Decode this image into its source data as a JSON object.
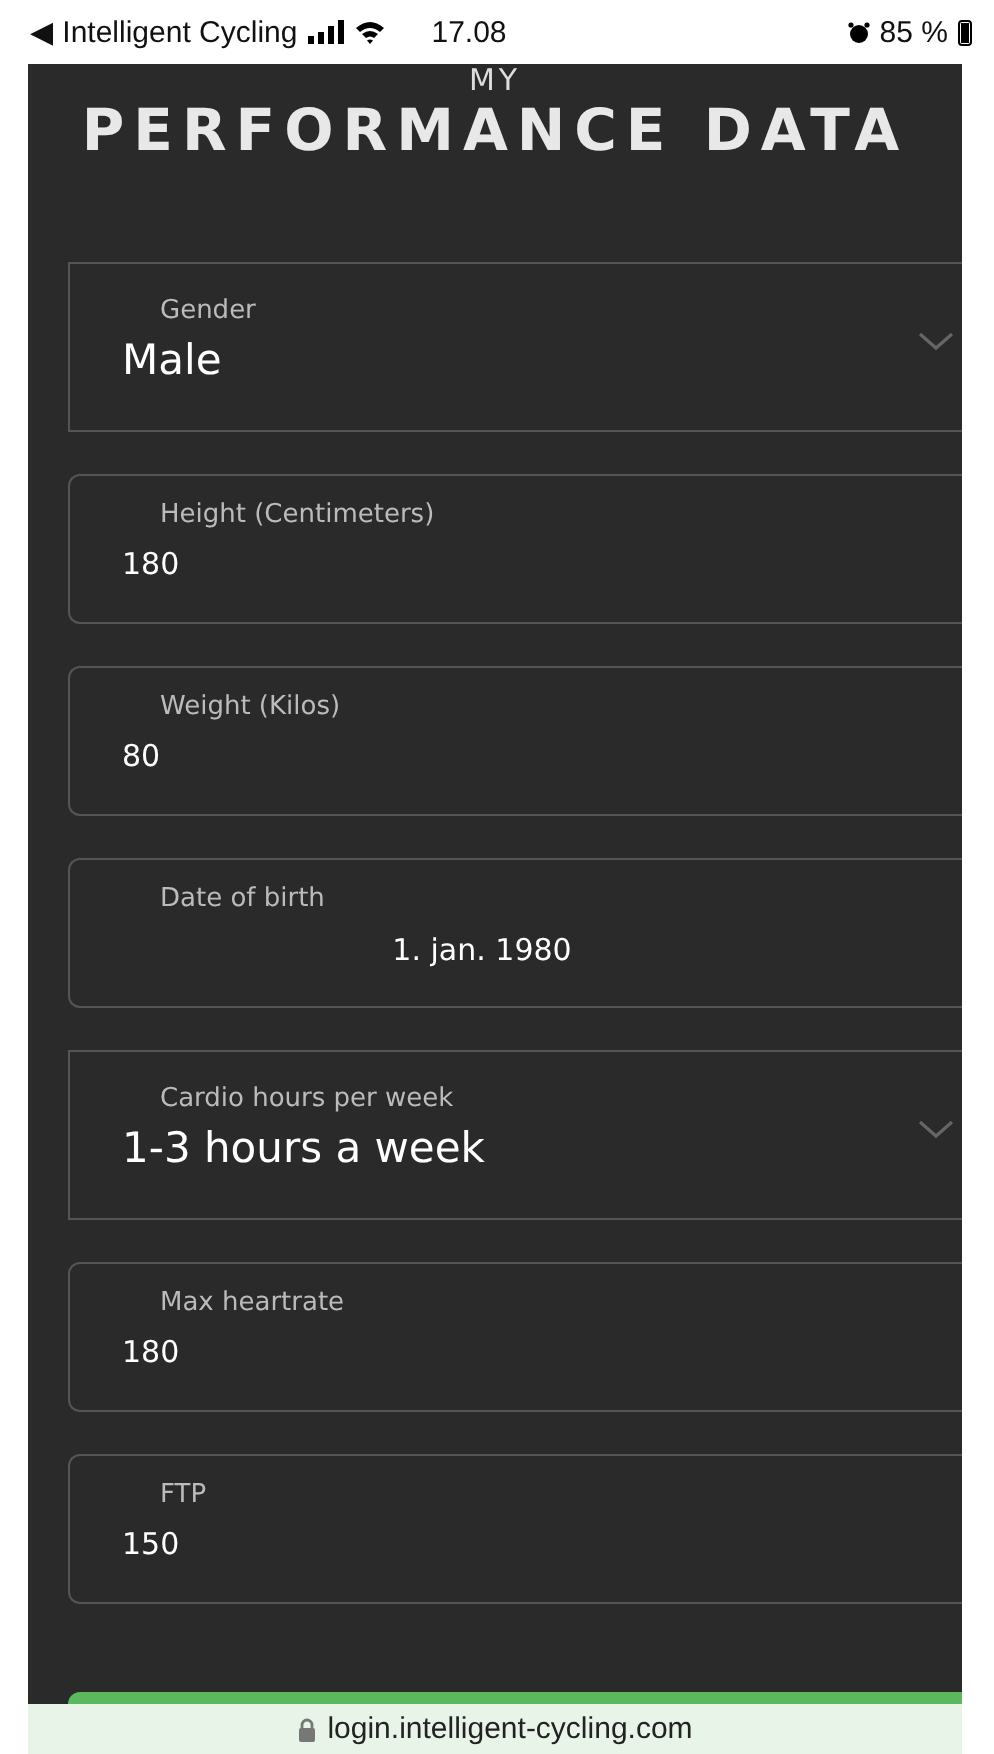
{
  "status_bar": {
    "back_app": "◀ Intelligent Cycling",
    "time": "17.08",
    "battery": "85 %"
  },
  "header": {
    "subtitle": "MY",
    "title": "PERFORMANCE DATA"
  },
  "fields": [
    {
      "kind": "select",
      "label": "Gender",
      "value": "Male"
    },
    {
      "kind": "input",
      "label": "Height (Centimeters)",
      "value": "180"
    },
    {
      "kind": "input",
      "label": "Weight (Kilos)",
      "value": "80"
    },
    {
      "kind": "date",
      "label": "Date of birth",
      "value": "1. jan. 1980"
    },
    {
      "kind": "select",
      "label": "Cardio hours per week",
      "value": "1-3 hours a week"
    },
    {
      "kind": "input",
      "label": "Max heartrate",
      "value": "180"
    },
    {
      "kind": "input",
      "label": "FTP",
      "value": "150"
    }
  ],
  "url_bar": {
    "url": "login.intelligent-cycling.com"
  }
}
